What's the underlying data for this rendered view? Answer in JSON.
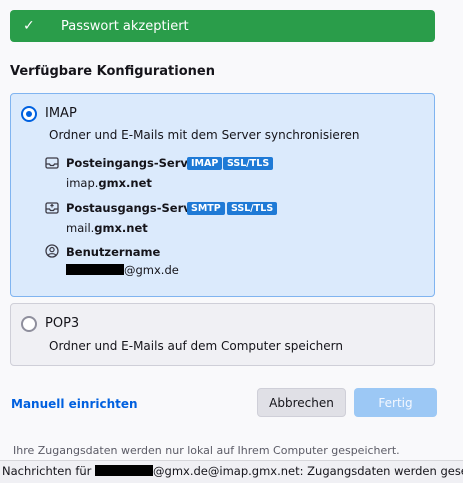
{
  "banner": {
    "icon": "check-icon",
    "text": "Passwort akzeptiert"
  },
  "section_title": "Verfügbare Konfigurationen",
  "imap": {
    "label": "IMAP",
    "selected": true,
    "description": "Ordner und E-Mails mit dem Server synchronisieren",
    "incoming": {
      "icon": "inbox-tray-icon",
      "label": "Posteingangs-Server",
      "badges": [
        "IMAP",
        "SSL/TLS"
      ],
      "host_prefix": "imap.",
      "host_domain": "gmx.net"
    },
    "outgoing": {
      "icon": "outbox-tray-icon",
      "label": "Postausgangs-Server",
      "badges": [
        "SMTP",
        "SSL/TLS"
      ],
      "host_prefix": "mail.",
      "host_domain": "gmx.net"
    },
    "username": {
      "icon": "user-icon",
      "label": "Benutzername",
      "suffix": "@gmx.de"
    }
  },
  "pop3": {
    "label": "POP3",
    "selected": false,
    "description": "Ordner und E-Mails auf dem Computer speichern"
  },
  "actions": {
    "manual_link": "Manuell einrichten",
    "cancel": "Abbrechen",
    "done": "Fertig"
  },
  "footnote": "Ihre Zugangsdaten werden nur lokal auf Ihrem Computer gespeichert.",
  "status": {
    "prefix": "Nachrichten für ",
    "suffix": "@gmx.de@imap.gmx.net: Zugangsdaten werden gesendet..."
  },
  "colors": {
    "success": "#2a9d4a",
    "accent": "#0061e0",
    "selected_bg": "#dbeafc"
  }
}
